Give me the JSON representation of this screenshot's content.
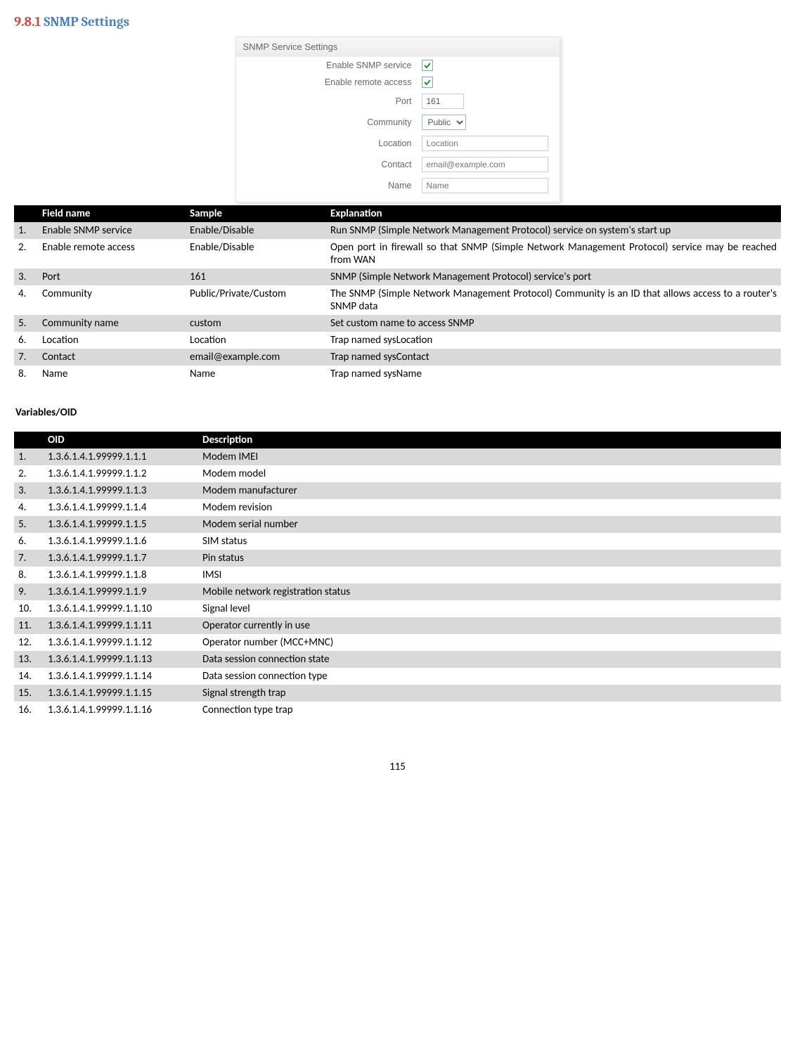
{
  "heading": {
    "number": "9.8.1",
    "title": "SNMP Settings"
  },
  "screenshot": {
    "panel_title": "SNMP Service Settings",
    "rows": {
      "enable_service_label": "Enable SNMP service",
      "enable_remote_label": "Enable remote access",
      "port_label": "Port",
      "port_value": "161",
      "community_label": "Community",
      "community_value": "Public",
      "location_label": "Location",
      "location_placeholder": "Location",
      "contact_label": "Contact",
      "contact_placeholder": "email@example.com",
      "name_label": "Name",
      "name_placeholder": "Name"
    }
  },
  "fields_table": {
    "headers": {
      "num": "",
      "field": "Field name",
      "sample": "Sample",
      "expl": "Explanation"
    },
    "rows": [
      {
        "num": "1.",
        "field": "Enable SNMP service",
        "sample": "Enable/Disable",
        "expl": "Run SNMP (Simple Network Management Protocol) service on system's start up"
      },
      {
        "num": "2.",
        "field": "Enable remote access",
        "sample": "Enable/Disable",
        "expl": "Open port in firewall so that SNMP (Simple Network Management Protocol) service may be reached from WAN"
      },
      {
        "num": "3.",
        "field": "Port",
        "sample": "161",
        "expl": "SNMP (Simple Network Management Protocol) service's port"
      },
      {
        "num": "4.",
        "field": "Community",
        "sample": "Public/Private/Custom",
        "expl": "The SNMP (Simple Network Management Protocol) Community is an ID that allows access to a router's SNMP data"
      },
      {
        "num": "5.",
        "field": "Community name",
        "sample": "custom",
        "expl": "Set custom name to access SNMP"
      },
      {
        "num": "6.",
        "field": "Location",
        "sample": "Location",
        "expl": "Trap named sysLocation"
      },
      {
        "num": "7.",
        "field": "Contact",
        "sample": "email@example.com",
        "expl": "Trap named sysContact"
      },
      {
        "num": "8.",
        "field": "Name",
        "sample": "Name",
        "expl": "Trap named sysName"
      }
    ]
  },
  "subheading": "Variables/OID",
  "oid_table": {
    "headers": {
      "num": "",
      "oid": "OID",
      "desc": "Description"
    },
    "rows": [
      {
        "num": "1.",
        "oid": "1.3.6.1.4.1.99999.1.1.1",
        "desc": "Modem IMEI"
      },
      {
        "num": "2.",
        "oid": "1.3.6.1.4.1.99999.1.1.2",
        "desc": "Modem model"
      },
      {
        "num": "3.",
        "oid": "1.3.6.1.4.1.99999.1.1.3",
        "desc": "Modem manufacturer"
      },
      {
        "num": "4.",
        "oid": "1.3.6.1.4.1.99999.1.1.4",
        "desc": "Modem revision"
      },
      {
        "num": "5.",
        "oid": "1.3.6.1.4.1.99999.1.1.5",
        "desc": "Modem serial number"
      },
      {
        "num": "6.",
        "oid": "1.3.6.1.4.1.99999.1.1.6",
        "desc": "SIM status"
      },
      {
        "num": "7.",
        "oid": "1.3.6.1.4.1.99999.1.1.7",
        "desc": "Pin status"
      },
      {
        "num": "8.",
        "oid": "1.3.6.1.4.1.99999.1.1.8",
        "desc": "IMSI"
      },
      {
        "num": "9.",
        "oid": "1.3.6.1.4.1.99999.1.1.9",
        "desc": "Mobile network registration status"
      },
      {
        "num": "10.",
        "oid": "1.3.6.1.4.1.99999.1.1.10",
        "desc": "Signal level"
      },
      {
        "num": "11.",
        "oid": "1.3.6.1.4.1.99999.1.1.11",
        "desc": "Operator currently in use"
      },
      {
        "num": "12.",
        "oid": "1.3.6.1.4.1.99999.1.1.12",
        "desc": "Operator number (MCC+MNC)"
      },
      {
        "num": "13.",
        "oid": "1.3.6.1.4.1.99999.1.1.13",
        "desc": "Data session connection state"
      },
      {
        "num": "14.",
        "oid": "1.3.6.1.4.1.99999.1.1.14",
        "desc": "Data session connection type"
      },
      {
        "num": "15.",
        "oid": "1.3.6.1.4.1.99999.1.1.15",
        "desc": "Signal strength trap"
      },
      {
        "num": "16.",
        "oid": "1.3.6.1.4.1.99999.1.1.16",
        "desc": "Connection type trap"
      }
    ]
  },
  "page_number": "115"
}
